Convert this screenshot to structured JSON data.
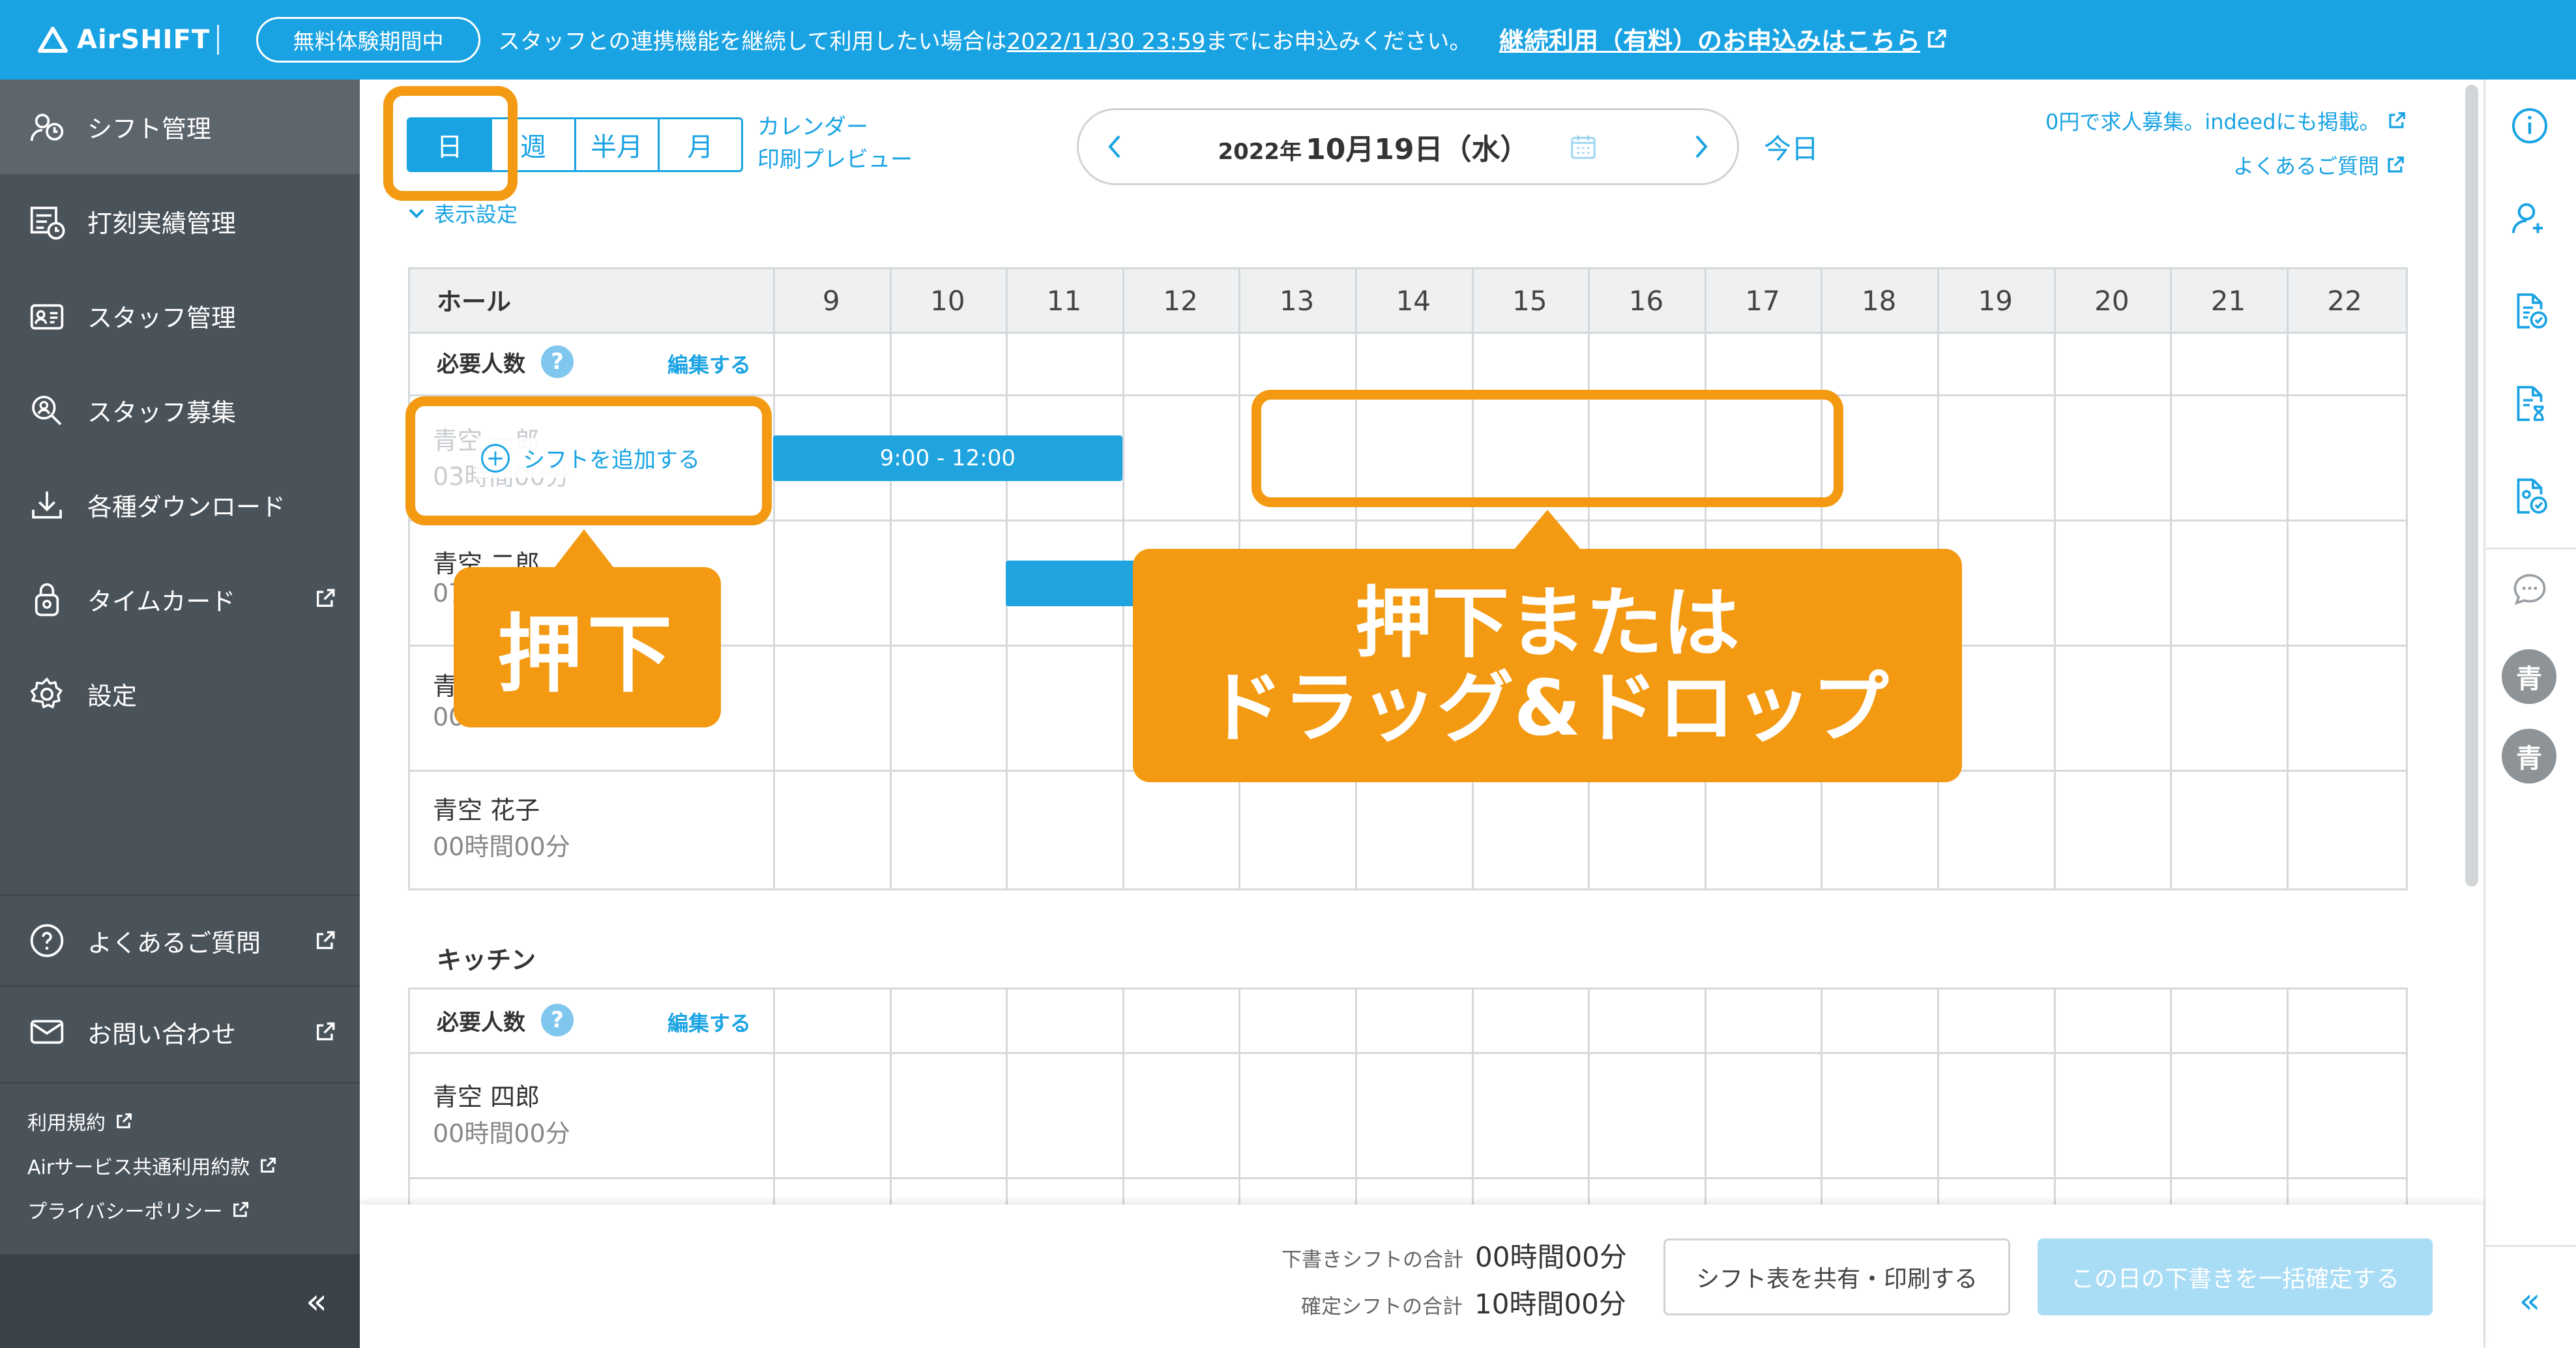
{
  "banner": {
    "logo": "AirSHIFT",
    "trial_badge": "無料体験期間中",
    "message_pre": "スタッフとの連携機能を継続して利用したい場合は",
    "message_date": "2022/11/30 23:59",
    "message_post": "までにお申込みください。",
    "apply_link": "継続利用（有料）のお申込みはこちら"
  },
  "sidebar": {
    "items": [
      {
        "label": "シフト管理",
        "icon": "shift-icon"
      },
      {
        "label": "打刻実績管理",
        "icon": "timestamp-icon"
      },
      {
        "label": "スタッフ管理",
        "icon": "staff-card-icon"
      },
      {
        "label": "スタッフ募集",
        "icon": "recruit-search-icon"
      },
      {
        "label": "各種ダウンロード",
        "icon": "download-icon"
      },
      {
        "label": "タイムカード",
        "icon": "timecard-lock-icon"
      },
      {
        "label": "設定",
        "icon": "gear-icon"
      }
    ],
    "faq": "よくあるご質問",
    "contact": "お問い合わせ",
    "legal": [
      "利用規約",
      "Airサービス共通利用約款",
      "プライバシーポリシー"
    ],
    "collapse": "«"
  },
  "toolbar": {
    "views": [
      "日",
      "週",
      "半月",
      "月"
    ],
    "calendar_link": "カレンダー",
    "print_link": "印刷プレビュー",
    "display_settings": "表示設定",
    "date_year": "2022年",
    "date_main": "10月19日（水）",
    "today": "今日",
    "recruit_link": "0円で求人募集。indeedにも掲載。",
    "faq_link": "よくあるご質問"
  },
  "hours": [
    "9",
    "10",
    "11",
    "12",
    "13",
    "14",
    "15",
    "16",
    "17",
    "18",
    "19",
    "20",
    "21",
    "22"
  ],
  "hall": {
    "title": "ホール",
    "required": "必要人数",
    "edit": "編集する",
    "help": "?",
    "staff": [
      {
        "name": "青空 一郎",
        "time": "03時間00分",
        "shift": "9:00 - 12:00",
        "shift_start": 9,
        "shift_end": 12
      },
      {
        "name": "青空 二郎",
        "time": "07",
        "shift": "",
        "shift_start": 11,
        "shift_end": 18
      },
      {
        "name": "青",
        "time": "00",
        "shift": "",
        "shift_start": null,
        "shift_end": null
      },
      {
        "name": "青空 花子",
        "time": "00時間00分",
        "shift": "",
        "shift_start": null,
        "shift_end": null
      }
    ],
    "add_shift": "シフトを追加する"
  },
  "kitchen": {
    "title": "キッチン",
    "required": "必要人数",
    "edit": "編集する",
    "help": "?",
    "staff": [
      {
        "name": "青空 四郎",
        "time": "00時間00分"
      }
    ]
  },
  "callouts": {
    "press": "押下",
    "press_or_drag_1": "押下または",
    "press_or_drag_2": "ドラッグ&ドロップ"
  },
  "footer": {
    "draft_label": "下書きシフトの合計",
    "draft_value": "00時間00分",
    "confirmed_label": "確定シフトの合計",
    "confirmed_value": "10時間00分",
    "share_button": "シフト表を共有・印刷する",
    "confirm_button": "この日の下書きを一括確定する"
  },
  "rail": {
    "icons": [
      "info-icon",
      "add-user-icon",
      "document-check-icon",
      "document-hourglass-icon",
      "document-person-icon",
      "chat-icon"
    ],
    "avatars": [
      "青",
      "青"
    ],
    "collapse": "«"
  },
  "colors": {
    "brand": "#19a3e3",
    "sidebar": "#4a525a",
    "annotation": "#f39a12"
  }
}
